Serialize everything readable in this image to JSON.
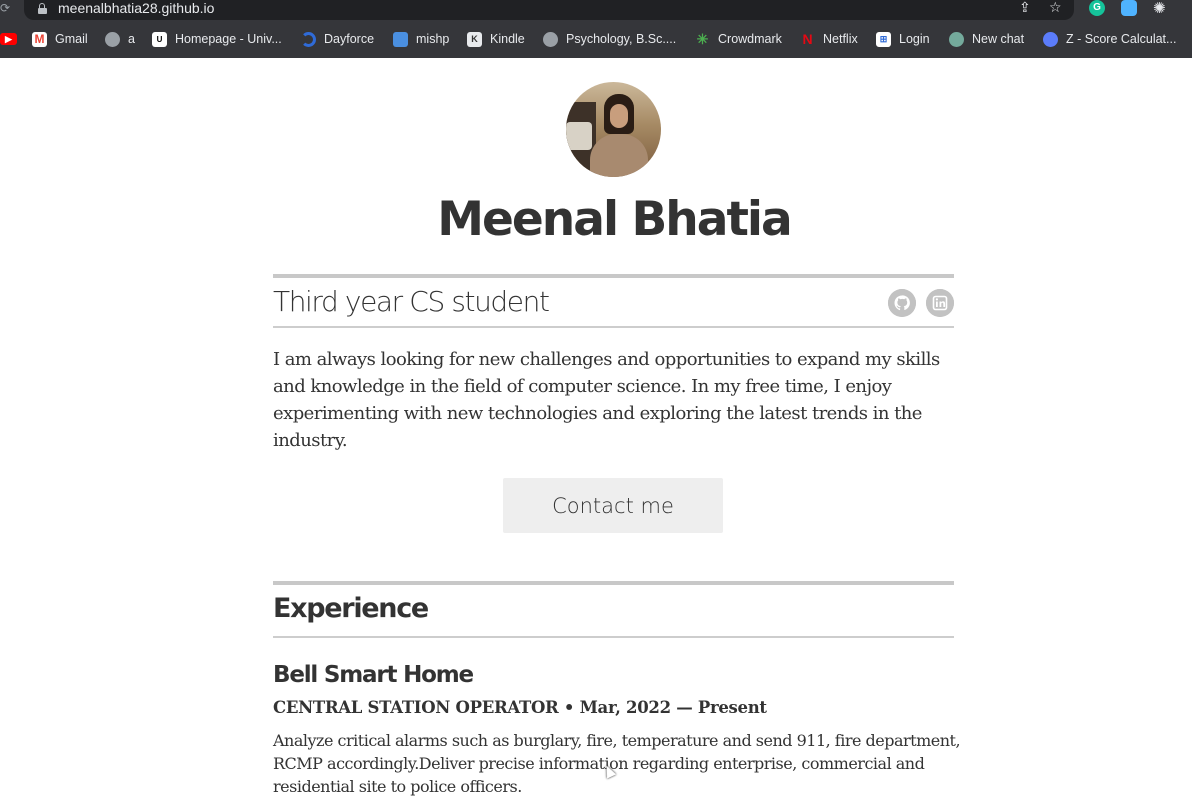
{
  "browser": {
    "url": "meenalbhatia28.github.io",
    "extensions": [
      "grammarly",
      "icloud",
      "chatgpt"
    ],
    "bookmarks": [
      {
        "label": "",
        "icon": "youtube-icon",
        "color": "#ff0000"
      },
      {
        "label": "Gmail",
        "icon": "gmail-icon",
        "color": "#ea4335"
      },
      {
        "label": "a",
        "icon": "globe-icon",
        "color": "#9aa0a6"
      },
      {
        "label": "Homepage - Univ...",
        "icon": "university-icon",
        "color": "#ffffff"
      },
      {
        "label": "Dayforce",
        "icon": "dayforce-icon",
        "color": "#2f6bd8"
      },
      {
        "label": "mishp",
        "icon": "mishp-icon",
        "color": "#4a8fe0"
      },
      {
        "label": "Kindle",
        "icon": "kindle-icon",
        "color": "#e8eaed"
      },
      {
        "label": "Psychology, B.Sc....",
        "icon": "psychology-icon",
        "color": "#9aa0a6"
      },
      {
        "label": "Crowdmark",
        "icon": "crowdmark-icon",
        "color": "#4caf50"
      },
      {
        "label": "Netflix",
        "icon": "netflix-icon",
        "color": "#e50914"
      },
      {
        "label": "Login",
        "icon": "login-icon",
        "color": "#ffffff"
      },
      {
        "label": "New chat",
        "icon": "chatgpt-icon",
        "color": "#74aa9c"
      },
      {
        "label": "Z - Score Calculat...",
        "icon": "calculator-icon",
        "color": "#5b7cfa"
      }
    ]
  },
  "profile": {
    "name": "Meenal Bhatia",
    "tagline": "Third year CS student",
    "intro": "I am always looking for new challenges and opportunities to expand my skills and knowledge in the field of computer science. In my free time, I enjoy experimenting with new technologies and exploring the latest trends in the industry.",
    "contact_label": "Contact me",
    "social": [
      "github-icon",
      "linkedin-icon"
    ]
  },
  "experience": {
    "title": "Experience",
    "items": [
      {
        "company": "Bell Smart Home",
        "role_line": "CENTRAL STATION OPERATOR • Mar, 2022 — Present",
        "description": "Analyze critical alarms such as burglary, fire, temperature and send 911, fire department, RCMP accordingly.Deliver precise information regarding enterprise, commercial and residential site to police officers."
      }
    ]
  },
  "colors": {
    "text": "#333333",
    "rule": "#c8c8c8",
    "button_bg": "#eeeeee",
    "social_icon": "#c2c2c2",
    "chrome_bg": "#35363a"
  }
}
